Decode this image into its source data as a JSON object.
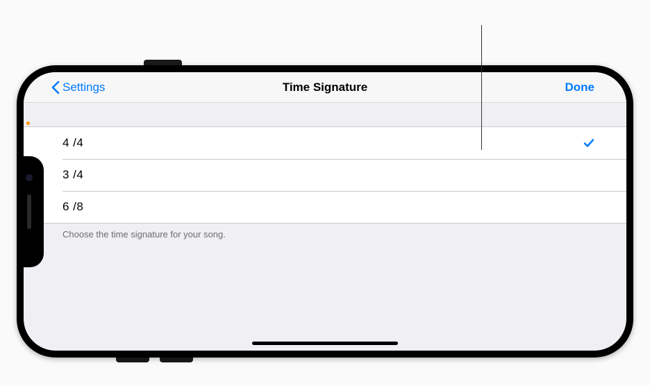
{
  "nav": {
    "back_label": "Settings",
    "title": "Time Signature",
    "done_label": "Done"
  },
  "options": [
    {
      "label": "4 /4",
      "selected": true
    },
    {
      "label": "3 /4",
      "selected": false
    },
    {
      "label": "6 /8",
      "selected": false
    }
  ],
  "footer": "Choose the time signature for your song.",
  "colors": {
    "accent": "#007aff",
    "background": "#efeff4",
    "row_bg": "#ffffff",
    "separator": "#c8c7cc"
  }
}
